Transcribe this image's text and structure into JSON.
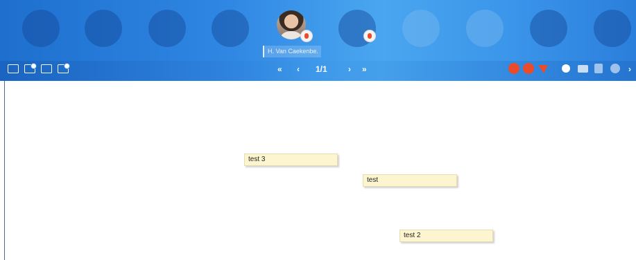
{
  "participant": {
    "name": "H. Van Caekenbe."
  },
  "toolbar": {
    "first": "«",
    "prev": "‹",
    "page": "1/1",
    "next": "›",
    "last": "»",
    "more": "›"
  },
  "icons": {
    "left": [
      "whiteboard-icon",
      "screen-share-icon",
      "presentation-icon",
      "document-icon"
    ],
    "right": [
      "microphone-icon",
      "camera-record-icon",
      "pointer-icon",
      "brightness-icon",
      "snapshot-icon",
      "clip-icon",
      "refresh-icon"
    ]
  },
  "notes": [
    {
      "text": "test 3"
    },
    {
      "text": "test"
    },
    {
      "text": "test 2"
    }
  ],
  "colors": {
    "accent": "#e94b2b",
    "header": "#2f86e3",
    "note": "#fdf5cf"
  }
}
